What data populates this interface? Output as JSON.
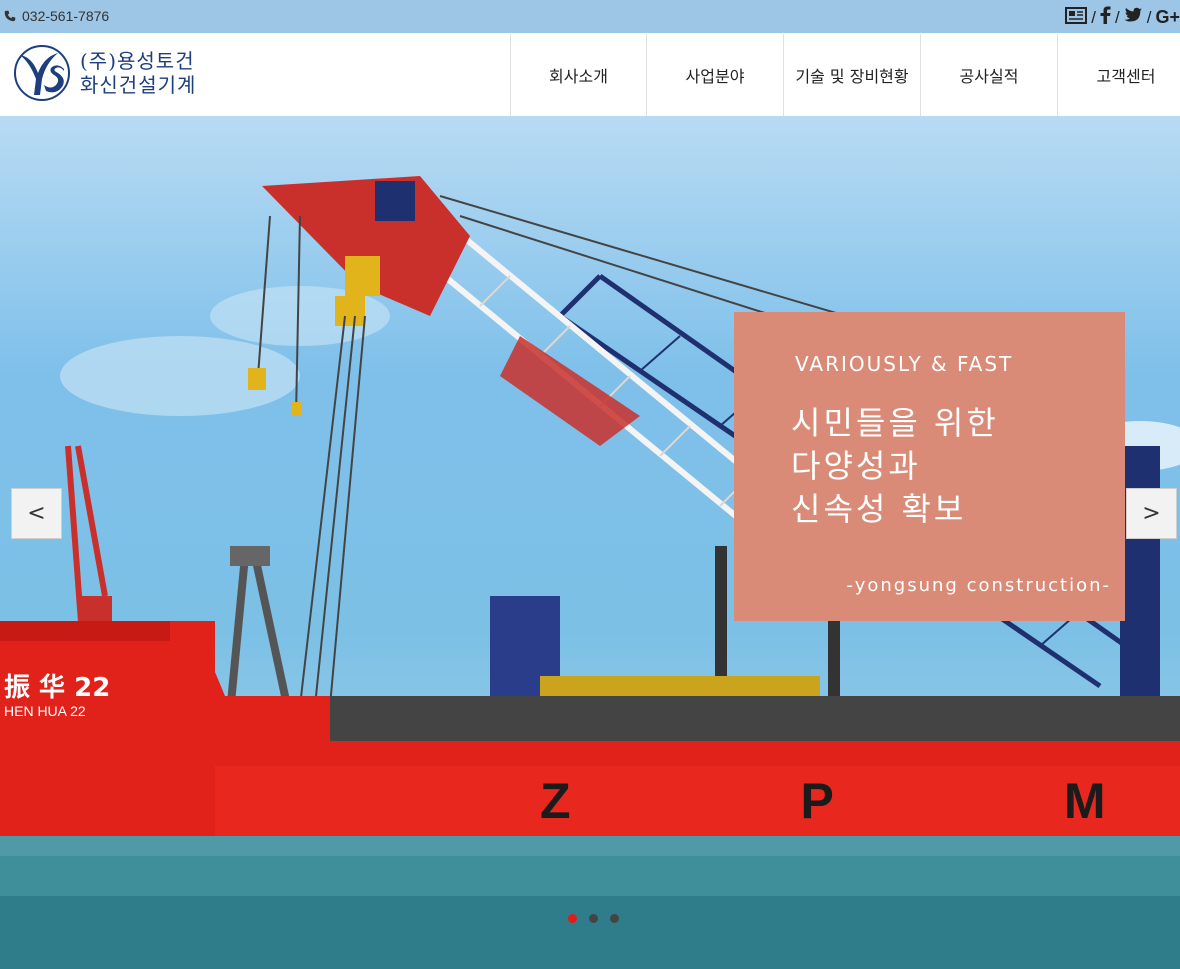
{
  "topbar": {
    "phone": "032-561-7876",
    "icons": [
      "news-icon",
      "facebook-icon",
      "twitter-icon",
      "google-icon"
    ],
    "separator": "/"
  },
  "header": {
    "logo_line1": "(주)용성토건",
    "logo_line2": "화신건설기계",
    "brand_color": "#1d3f7d",
    "nav": [
      {
        "label": "회사소개"
      },
      {
        "label": "사업분야"
      },
      {
        "label": "기술 및 장비현황"
      },
      {
        "label": "공사실적"
      },
      {
        "label": "고객센터"
      }
    ]
  },
  "hero": {
    "subtitle": "VARIOUSLY & FAST",
    "title_lines": [
      "시민들을 위한",
      "다양성과",
      "신속성 확보"
    ],
    "footer": "-yongsung construction-",
    "caption_color": "#d98b78",
    "prev_label": "<",
    "next_label": ">",
    "slides_count": 3,
    "active_slide": 1,
    "ship_text": [
      "振 华 22",
      "HEN HUA 22",
      "ZPM"
    ]
  }
}
